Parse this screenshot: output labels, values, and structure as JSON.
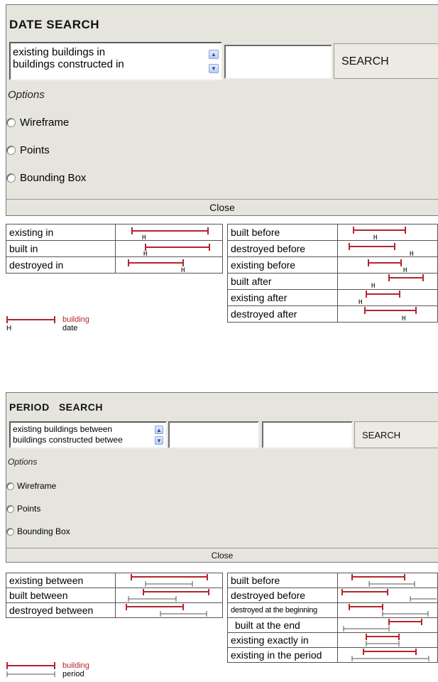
{
  "date_search": {
    "title": "DATE SEARCH",
    "query_types": [
      "existing buildings in",
      "buildings constructed in"
    ],
    "date_value": "",
    "search_label": "SEARCH",
    "options_label": "Options",
    "options": [
      "Wireframe",
      "Points",
      "Bounding Box"
    ],
    "close_label": "Close"
  },
  "date_legend": {
    "left_rows": [
      "existing in",
      "built in",
      "destroyed in"
    ],
    "right_rows": [
      "built before",
      "destroyed before",
      "existing before",
      "built after",
      "existing after",
      "destroyed after"
    ],
    "key": {
      "building": "building",
      "date": "date",
      "marker": "H"
    }
  },
  "period_search": {
    "title": "PERIOD   SEARCH",
    "query_types": [
      "existing buildings between",
      "buildings constructed betwee"
    ],
    "start_value": "",
    "end_value": "",
    "search_label": "SEARCH",
    "options_label": "Options",
    "options": [
      "Wireframe",
      "Points",
      "Bounding Box"
    ],
    "close_label": "Close"
  },
  "period_legend": {
    "left_rows": [
      "existing between",
      "built between",
      "destroyed between"
    ],
    "right_rows": [
      "built before",
      "destroyed before",
      "destroyed at the beginning",
      "built at the end",
      "existing exactly in",
      "existing in the period"
    ],
    "key": {
      "building": "building",
      "period": "period"
    }
  },
  "colors": {
    "building": "#b3262b",
    "period": "#555555",
    "panel": "#e6e5dd"
  }
}
